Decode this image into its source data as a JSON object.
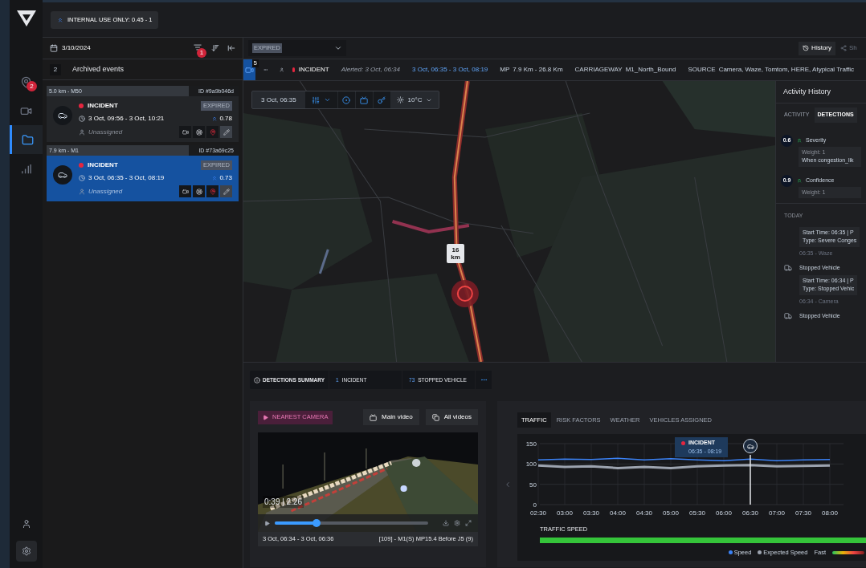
{
  "top_bar": {
    "range_chip": "INTERNAL USE ONLY: 0.45 - 1"
  },
  "nav_rail": {
    "items": [
      {
        "kind": "pin",
        "badge": "2",
        "selected": false
      },
      {
        "kind": "camera",
        "selected": false
      },
      {
        "kind": "folder",
        "selected": true
      },
      {
        "kind": "chart",
        "selected": false
      }
    ],
    "bottom_items": [
      {
        "kind": "user"
      },
      {
        "kind": "settings"
      }
    ]
  },
  "events_panel": {
    "date": "3/10/2024",
    "filter_badge": "1",
    "count": "2",
    "title": "Archived events",
    "events": [
      {
        "distance": "5.0 km - M50",
        "id": "ID #9a9b046d",
        "type": "INCIDENT",
        "status": "EXPIRED",
        "time": "3 Oct, 09:56 - 3 Oct, 10:21",
        "score": "0.78",
        "assignee": "Unassigned",
        "selected": false
      },
      {
        "distance": "7.9 km - M1",
        "id": "ID #73a69c25",
        "type": "INCIDENT",
        "status": "EXPIRED",
        "time": "3 Oct, 06:35 - 3 Oct, 08:19",
        "score": "0.73",
        "assignee": "Unassigned",
        "selected": true
      }
    ]
  },
  "header": {
    "status_filter": "EXPIRED",
    "history_button": "History",
    "share_button": "Sh"
  },
  "incident_bar": {
    "badge": "5",
    "type": "INCIDENT",
    "alerted": "Alerted: 3 Oct, 06:34",
    "period": "3 Oct, 06:35 - 3 Oct, 08:19",
    "fields": [
      {
        "label": "MP",
        "value": "7.9 Km - 26.8 Km"
      },
      {
        "label": "CARRIAGEWAY",
        "value": "M1_North_Bound"
      },
      {
        "label": "SOURCE",
        "value": "Camera, Waze, Tomtom, HERE, Atypical Traffic"
      }
    ]
  },
  "map": {
    "time": "3 Oct, 06:35",
    "temperature": "10°C",
    "layers": [
      {
        "kind": "circle"
      },
      {
        "kind": "camera"
      },
      {
        "kind": "road"
      }
    ],
    "km_marker": {
      "value": "16",
      "unit": "km"
    }
  },
  "activity": {
    "title": "Activity History",
    "tabs": [
      {
        "label": "ACTIVITY",
        "selected": false
      },
      {
        "label": "DETECTIONS",
        "selected": true
      }
    ],
    "factors": [
      {
        "score": "0.6",
        "name": "Severity",
        "weight": "Weight: 1",
        "detail": "When congestion_lik"
      },
      {
        "score": "0.9",
        "name": "Confidence",
        "weight": "Weight: 1"
      }
    ],
    "day": "TODAY",
    "entries": [
      {
        "kind": "congestion",
        "lines": [
          "Start Time: 06:35 | P",
          "Type: Severe Conges"
        ],
        "source": "06:35 - Waze"
      },
      {
        "kind": "vehicle",
        "title": "Stopped Vehicle",
        "lines": [
          "Start Time: 06:34 | P",
          "Type: Stopped Vehic"
        ],
        "source": "06:34 - Camera"
      },
      {
        "kind": "vehicle",
        "title": "Stopped Vehicle"
      }
    ]
  },
  "detections_summary": {
    "title": "DETECTIONS SUMMARY",
    "counts": [
      {
        "count": "1",
        "label": "INCIDENT"
      },
      {
        "count": "73",
        "label": "STOPPED VEHICLE"
      }
    ]
  },
  "camera": {
    "nearest": "NEAREST CAMERA",
    "buttons": [
      {
        "kind": "main",
        "label": "Main video"
      },
      {
        "kind": "all",
        "label": "All videos"
      }
    ],
    "player": {
      "time": "0:39 | 2:26",
      "level": 0.27
    },
    "caption_time": "3 Oct, 06:34 - 3 Oct, 06:36",
    "caption_location": "[109] - M1(S) MP15.4 Before J5 (9)"
  },
  "traffic": {
    "tabs": [
      {
        "label": "TRAFFIC",
        "selected": true
      },
      {
        "label": "RISK FACTORS",
        "selected": false
      },
      {
        "label": "WEATHER",
        "selected": false
      },
      {
        "label": "VEHICLES ASSIGNED",
        "selected": false
      }
    ],
    "chart_data": {
      "type": "line",
      "grid": true,
      "ref_lines": [
        {
          "axis": "x",
          "value": "06:30"
        }
      ],
      "categories": [
        "02:30",
        "03:00",
        "03:30",
        "04:00",
        "04:30",
        "05:00",
        "05:30",
        "06:00",
        "06:30",
        "07:00",
        "07:30",
        "08:00"
      ],
      "ylim": [
        0,
        150
      ],
      "yticks": [
        0,
        50,
        100,
        150
      ],
      "series": [
        {
          "name": "Speed",
          "color": "#3b82f6",
          "values": [
            110,
            112,
            111,
            114,
            110,
            113,
            110,
            108,
            112,
            108,
            110,
            111
          ]
        },
        {
          "name": "Expected Speed",
          "color": "#9ca3af",
          "values": [
            96,
            93,
            94,
            90,
            93,
            90,
            94,
            96,
            97,
            94,
            95,
            96
          ]
        }
      ]
    },
    "tooltip": {
      "type": "INCIDENT",
      "period": "06:35 - 08:19"
    },
    "speed_bar": {
      "label": "TRAFFIC SPEED"
    },
    "legend_scale": "Fast"
  }
}
